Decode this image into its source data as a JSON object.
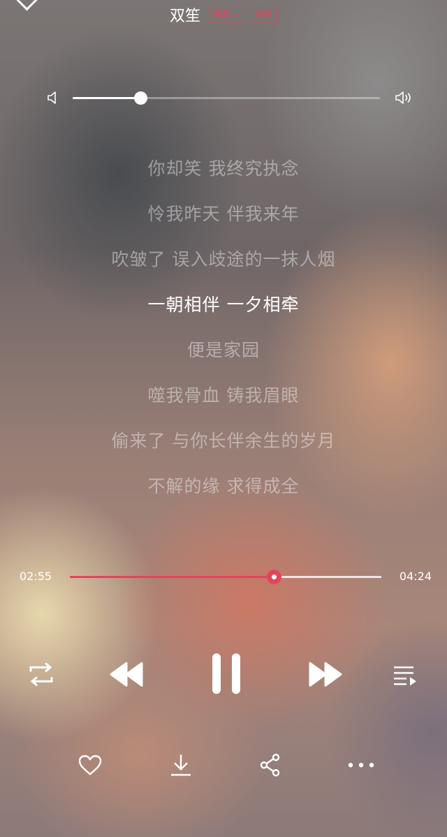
{
  "header": {
    "title": "双笙",
    "quality_tag": "标准",
    "lyrics_tag": "词条"
  },
  "volume": {
    "level": 0.22
  },
  "lyrics": [
    "你却笑 我终究执念",
    "怜我昨天 伴我来年",
    "吹皱了 误入歧途的一抹人烟",
    "一朝相伴 一夕相牵",
    "便是家园",
    "噬我骨血 铸我眉眼",
    "偷来了 与你长伴余生的岁月",
    "不解的缘 求得成全"
  ],
  "current_lyric_index": 3,
  "progress": {
    "current": "02:55",
    "total": "04:24",
    "fraction": 0.655
  },
  "colors": {
    "accent": "#e0455c"
  },
  "icons": {
    "controls": [
      "repeat-icon",
      "previous-icon",
      "pause-icon",
      "next-icon",
      "playlist-icon"
    ],
    "actions": [
      "heart-icon",
      "download-icon",
      "share-icon",
      "more-icon"
    ]
  }
}
